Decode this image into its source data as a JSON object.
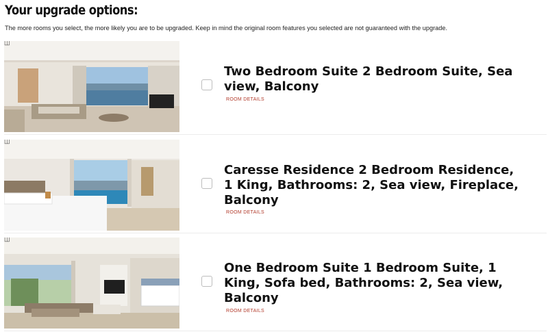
{
  "heading": "Your upgrade options:",
  "subtext": "The more rooms you select, the more likely you are to be upgraded. Keep in mind the original room features you selected are not guaranteed with the upgrade.",
  "rooms": [
    {
      "title": "Two Bedroom Suite 2 Bedroom Suite, Sea view, Balcony",
      "details_label": "ROOM DETAILS",
      "selected": false
    },
    {
      "title": "Caresse Residence 2 Bedroom Residence, 1 King, Bathrooms: 2, Sea view, Fireplace, Balcony",
      "details_label": "ROOM DETAILS",
      "selected": false
    },
    {
      "title": "One Bedroom Suite 1 Bedroom Suite, 1 King, Sofa bed, Bathrooms: 2, Sea view, Balcony",
      "details_label": "ROOM DETAILS",
      "selected": false
    }
  ],
  "colors": {
    "details_link": "#b23a2a",
    "title_text": "#111111",
    "checkbox_border": "#bdbdbd"
  }
}
